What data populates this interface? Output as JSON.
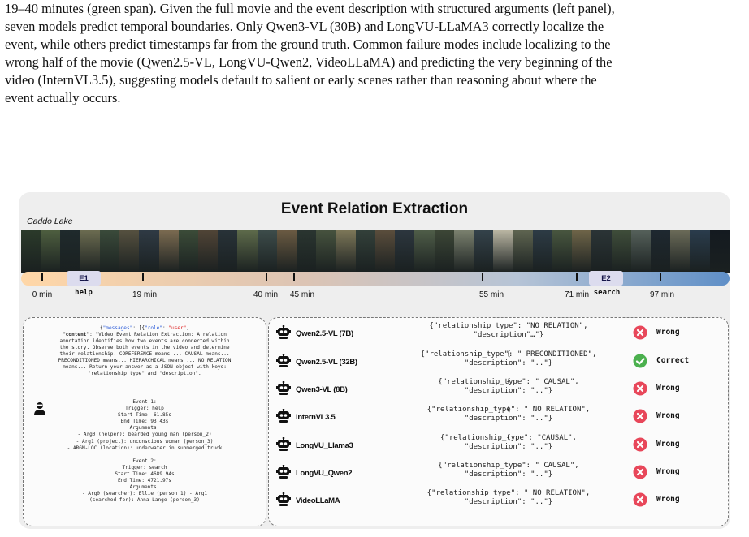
{
  "caption": {
    "lines": [
      "19–40 minutes (green span). Given the full movie and the event description with structured arguments (left panel),",
      "seven models predict temporal boundaries. Only Qwen3-VL (30B) and LongVU-LLaMA3 correctly localize the",
      "event, while others predict timestamps far from the ground truth. Common failure modes include localizing to the",
      "wrong half of the movie (Qwen2.5-VL, LongVU-Qwen2, VideoLLaMA) and predicting the very beginning of the",
      "video (InternVL3.5), suggesting models default to salient or early scenes rather than reasoning about where the",
      "event actually occurs."
    ]
  },
  "figure": {
    "title": "Event Relation Extraction",
    "movie_title": "Caddo Lake",
    "frame_colors": [
      "#2b3a2a",
      "#4e5e3f",
      "#1f2a2c",
      "#6b6b50",
      "#3a4a3a",
      "#55503f",
      "#2f3a44",
      "#7a6a50",
      "#3b4b38",
      "#504436",
      "#283238",
      "#5d6a4a",
      "#3d4c4a",
      "#6a5a42",
      "#2a3530",
      "#46523e",
      "#7c7658",
      "#33403a",
      "#5a4d3c",
      "#2c363e",
      "#4f5d48",
      "#3c4636",
      "#7a806e",
      "#34424a",
      "#b9b5a2",
      "#5e6450",
      "#2d3b45",
      "#48563f",
      "#6e6448",
      "#2b3436",
      "#3f4d3a",
      "#55605a",
      "#1e2830",
      "#6a6a58",
      "#2a3c4c",
      "#141a20"
    ],
    "events": [
      {
        "id": "E1",
        "name": "help"
      },
      {
        "id": "E2",
        "name": "search"
      }
    ],
    "ticks": [
      "0 min",
      "19 min",
      "40 min",
      "45 min",
      "55 min",
      "71 min",
      "97 min"
    ],
    "prompt": {
      "messages_key": "\"messages\"",
      "role_key": "\"role\"",
      "role_value": "\"user\"",
      "content_key": "\"content\"",
      "content_lines": [
        ": \"Video Event Relation Extraction: A relation",
        "annotation identifies how two events are connected within",
        "the story. Observe both events in the video and determine",
        "their relationship. COREFERENCE means ... CAUSAL means...",
        "PRECONDITIONED means... HIERARCHICAL means ... NO_RELATION",
        "means... Return your answer as a JSON object with keys:",
        "\"relationship_type\" and \"description\"."
      ],
      "event_lines": [
        "Event 1:",
        "Trigger: help",
        "Start Time: 61.85s",
        "End Time: 93.43s",
        "Arguments:",
        "- Arg0 (helper): bearded young man (person_2)",
        "- Arg1 (project): unconscious woman (person_3)",
        "- ARGM-LOC (location): underwater in submerged truck",
        "",
        "Event 2:",
        "Trigger: search",
        "Start Time: 4689.94s",
        "End Time: 4721.97s",
        "Arguments:",
        "- Arg0 (searcher): Ellie (person_1)     - Arg1",
        "(searched for): Anna Lange (person_3)"
      ]
    },
    "models": [
      {
        "name": "Qwen2.5-VL (7B)",
        "line1": "{\"relationship_type\": \"NO RELATION\",",
        "line2": "\"description\"…\"}",
        "line3": "",
        "result": "Wrong",
        "status": "wrong"
      },
      {
        "name": "Qwen2.5-VL (32B)",
        "line1": "{\"relationship_type\": \" PRECONDITIONED\",",
        "line2": "\"description\": \"..\"}",
        "line3": "{",
        "result": "Correct",
        "status": "correct"
      },
      {
        "name": "Qwen3-VL (8B)",
        "line1": "{\"relationship_type\": \" CAUSAL\",",
        "line2": "\"description\": \"..\"}",
        "line3": "{",
        "result": "Wrong",
        "status": "wrong"
      },
      {
        "name": "InternVL3.5",
        "line1": "{\"relationship_type\": \" NO RELATION\",",
        "line2": "\"description\": \"..\"}",
        "line3": "{",
        "result": "Wrong",
        "status": "wrong"
      },
      {
        "name": "LongVU_Llama3",
        "line1": "{\"relationship_type\": \"CAUSAL\",",
        "line2": "\"description\": \"..\"}",
        "line3": "{",
        "result": "Wrong",
        "status": "wrong"
      },
      {
        "name": "LongVU_Qwen2",
        "line1": "{\"relationship_type\": \" CAUSAL\",",
        "line2": "\"description\": \"..\"}",
        "line3": "",
        "result": "Wrong",
        "status": "wrong"
      },
      {
        "name": "VideoLLaMA",
        "line1": "{\"relationship_type\": \" NO RELATION\",",
        "line2": "\"description\": \"..\"}",
        "line3": "",
        "result": "Wrong",
        "status": "wrong"
      }
    ],
    "colors": {
      "wrong": "#e8475a",
      "correct": "#4bb04e",
      "event_box": "#dcdcee"
    }
  }
}
